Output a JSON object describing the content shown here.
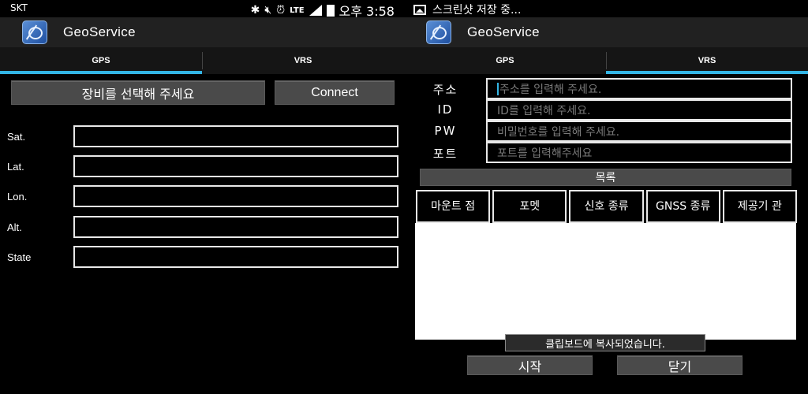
{
  "left": {
    "status": {
      "carrier": "SKT",
      "icons_text": "LTE",
      "time": "오후 3:58"
    },
    "app_title": "GeoService",
    "tabs": [
      {
        "label": "GPS",
        "active": true
      },
      {
        "label": "VRS",
        "active": false
      }
    ],
    "select_device_button": "장비를 선택해 주세요",
    "connect_button": "Connect",
    "fields": [
      {
        "label": "Sat.",
        "value": ""
      },
      {
        "label": "Lat.",
        "value": ""
      },
      {
        "label": "Lon.",
        "value": ""
      },
      {
        "label": "Alt.",
        "value": ""
      },
      {
        "label": "State",
        "value": ""
      }
    ]
  },
  "right": {
    "status": {
      "notification": "스크린샷 저장 중..."
    },
    "app_title": "GeoService",
    "tabs": [
      {
        "label": "GPS",
        "active": false
      },
      {
        "label": "VRS",
        "active": true
      }
    ],
    "form": [
      {
        "label": "주소",
        "placeholder": "주소를 입력해 주세요."
      },
      {
        "label": "ID",
        "placeholder": "ID를 입력해 주세요."
      },
      {
        "label": "PW",
        "placeholder": "비밀번호를 입력해 주세요."
      },
      {
        "label": "포트",
        "placeholder": "포트를 입력해주세요"
      }
    ],
    "list_title": "목록",
    "columns": [
      "마운트 점",
      "포멧",
      "신호 종류",
      "GNSS 종류",
      "제공기 관"
    ],
    "toast": "클립보드에 복사되었습니다.",
    "start_button": "시작",
    "close_button": "닫기"
  },
  "colors": {
    "accent": "#33b5e5",
    "button": "#4a4a4a",
    "actionbar": "#212121"
  }
}
